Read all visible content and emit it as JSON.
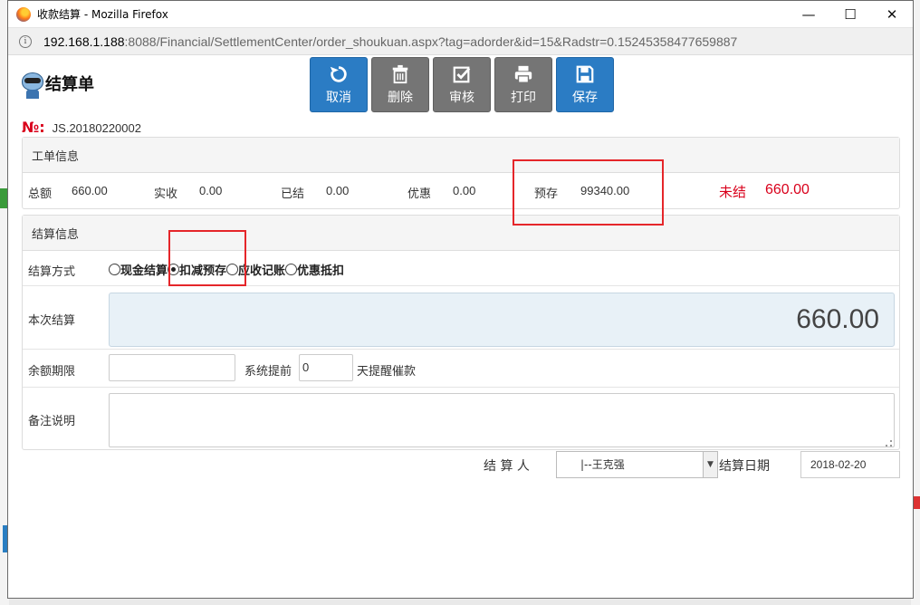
{
  "window": {
    "title": "收款结算 - Mozilla Firefox",
    "url_host": "192.168.1.188",
    "url_rest": ":8088/Financial/SettlementCenter/order_shoukuan.aspx?tag=adorder&id=15&Radstr=0.15245358477659887",
    "controls": {
      "minimize": "—",
      "maximize": "☐",
      "close": "✕"
    }
  },
  "header": {
    "logo_text": "结算单"
  },
  "toolbar": {
    "cancel": "取消",
    "delete": "删除",
    "review": "审核",
    "print": "打印",
    "save": "保存",
    "colors": {
      "blue": "#2b7cc4",
      "gray": "#757575"
    }
  },
  "order": {
    "label": "№:",
    "number": "JS.20180220002"
  },
  "work_info": {
    "heading": "工单信息",
    "total_label": "总额",
    "total_value": "660.00",
    "received_label": "实收",
    "received_value": "0.00",
    "settled_label": "已结",
    "settled_value": "0.00",
    "discount_label": "优惠",
    "discount_value": "0.00",
    "prepaid_label": "预存",
    "prepaid_value": "99340.00",
    "unsettled_label": "未结",
    "unsettled_value": "660.00"
  },
  "settlement": {
    "heading": "结算信息",
    "method_label": "结算方式",
    "methods": [
      {
        "label": "现金结算",
        "checked": false
      },
      {
        "label": "扣减预存",
        "checked": true
      },
      {
        "label": "应收记账",
        "checked": false
      },
      {
        "label": "优惠抵扣",
        "checked": false
      }
    ],
    "current_label": "本次结算",
    "current_amount": "660.00",
    "balance_term_label": "余额期限",
    "balance_term_value": "",
    "remind_prefix": "系统提前",
    "remind_days": "0",
    "remind_suffix": "天提醒催款",
    "remark_label": "备注说明",
    "remark_value": ""
  },
  "footer": {
    "settler_label": "结 算 人",
    "settler_value": "|--王克强",
    "date_label": "结算日期",
    "date_value": "2018-02-20"
  }
}
